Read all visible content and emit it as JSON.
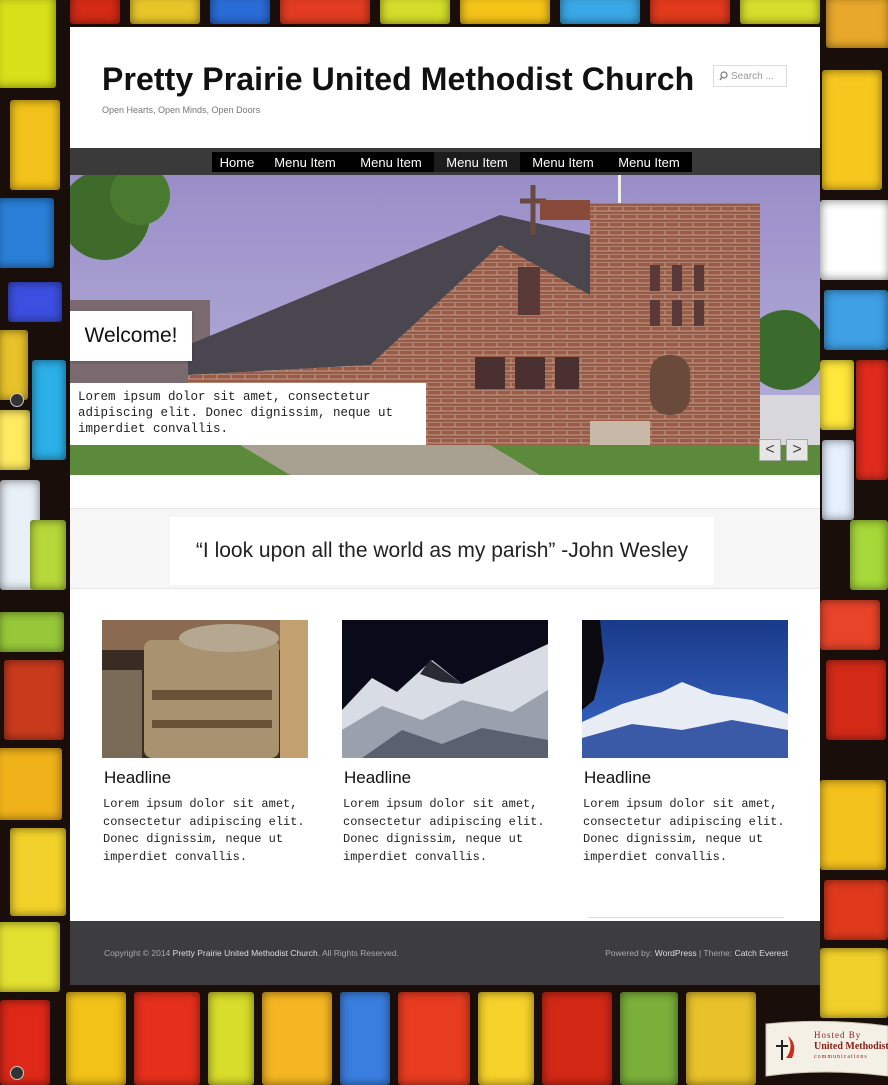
{
  "site": {
    "title": "Pretty Prairie United Methodist Church",
    "tagline": "Open Hearts, Open Minds, Open Doors"
  },
  "search": {
    "placeholder": "Search ..."
  },
  "nav": {
    "items": [
      "Home",
      "Menu Item",
      "Menu Item",
      "Menu Item",
      "Menu Item",
      "Menu Item"
    ],
    "active_index": 3
  },
  "slider": {
    "title": "Welcome!",
    "text": "Lorem ipsum dolor sit amet, consectetur adipiscing elit. Donec dignissim, neque ut imperdiet convallis.",
    "prev_label": "<",
    "next_label": ">"
  },
  "quote": {
    "text": "“I look upon all the world as my parish” -John Wesley"
  },
  "features": [
    {
      "headline": "Headline",
      "text": "Lorem ipsum dolor sit amet, consectetur adipiscing elit. Donec dignissim, neque ut imperdiet convallis."
    },
    {
      "headline": "Headline",
      "text": "Lorem ipsum dolor sit amet, consectetur adipiscing elit. Donec dignissim, neque ut imperdiet convallis."
    },
    {
      "headline": "Headline",
      "text": "Lorem ipsum dolor sit amet, consectetur adipiscing elit. Donec dignissim, neque ut imperdiet convallis."
    }
  ],
  "footer": {
    "copyright_prefix": "Copyright © 2014",
    "copyright_link": "Pretty Prairie United Methodist Church",
    "copyright_suffix": ". All Rights Reserved.",
    "powered_prefix": "Powered by:",
    "powered_link": "WordPress",
    "theme_prefix": " | Theme:",
    "theme_link": "Catch Everest"
  },
  "badge": {
    "line1": "Hosted By",
    "line2": "United Methodist",
    "line3": "communications"
  },
  "colors": {
    "nav_bg": "#3a3a3a",
    "nav_menu": "#000000",
    "footer_bg": "#3d3d3f",
    "page_bg": "#ffffff"
  },
  "icons": {
    "search": "magnifier-icon",
    "badge": "cross-and-flame-icon"
  }
}
